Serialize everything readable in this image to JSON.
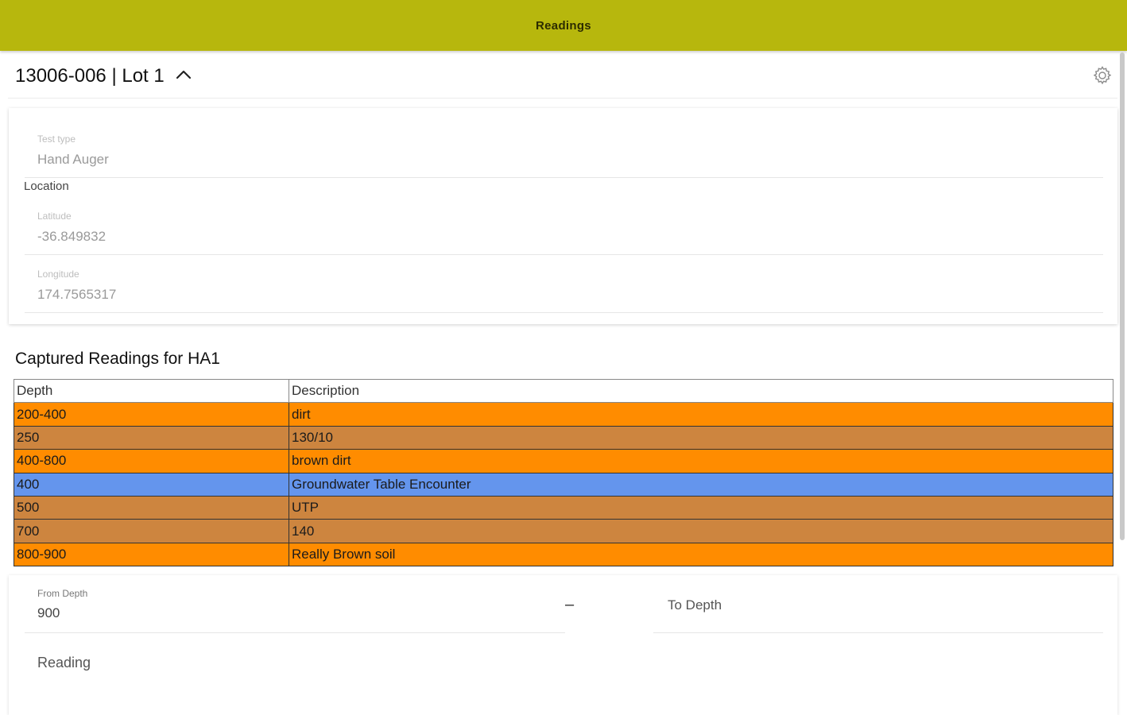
{
  "topbar": {
    "title": "Readings"
  },
  "header": {
    "project_title": "13006-006 | Lot 1"
  },
  "info": {
    "test_type_label": "Test type",
    "test_type_value": "Hand Auger",
    "location_label": "Location",
    "latitude_label": "Latitude",
    "latitude_value": "-36.849832",
    "longitude_label": "Longitude",
    "longitude_value": "174.7565317"
  },
  "readings": {
    "title": "Captured Readings for HA1",
    "columns": [
      "Depth",
      "Description"
    ],
    "rows": [
      {
        "depth": "200-400",
        "description": "dirt",
        "color": "#ff8c00"
      },
      {
        "depth": "250",
        "description": "130/10",
        "color": "#cd853f"
      },
      {
        "depth": "400-800",
        "description": "brown dirt",
        "color": "#ff8c00"
      },
      {
        "depth": "400",
        "description": "Groundwater Table Encounter",
        "color": "#6495ed"
      },
      {
        "depth": "500",
        "description": "UTP",
        "color": "#cd853f"
      },
      {
        "depth": "700",
        "description": "140",
        "color": "#cd853f"
      },
      {
        "depth": "800-900",
        "description": "Really Brown soil",
        "color": "#ff8c00"
      }
    ]
  },
  "entry": {
    "from_label": "From Depth",
    "from_value": "900",
    "dash": "–",
    "to_placeholder": "To Depth",
    "reading_placeholder": "Reading"
  },
  "icons": {
    "expand": "chevron-up-icon",
    "settings": "gear-icon"
  }
}
